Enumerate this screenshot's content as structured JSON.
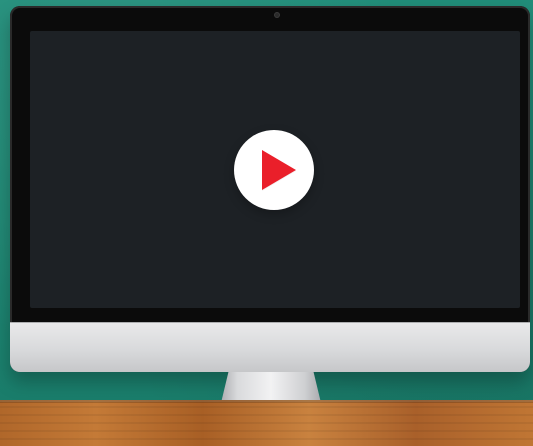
{
  "scene": {
    "colors": {
      "wall_green": "#1f8a76",
      "screen_dark": "#1d2125",
      "play_red": "#ea1f2a",
      "play_white": "#ffffff",
      "imac_silver": "#d8d9db",
      "desk_wood": "#b56f30"
    }
  },
  "monitor": {
    "logo": ""
  },
  "video_player": {
    "play_icon": "play-icon"
  }
}
